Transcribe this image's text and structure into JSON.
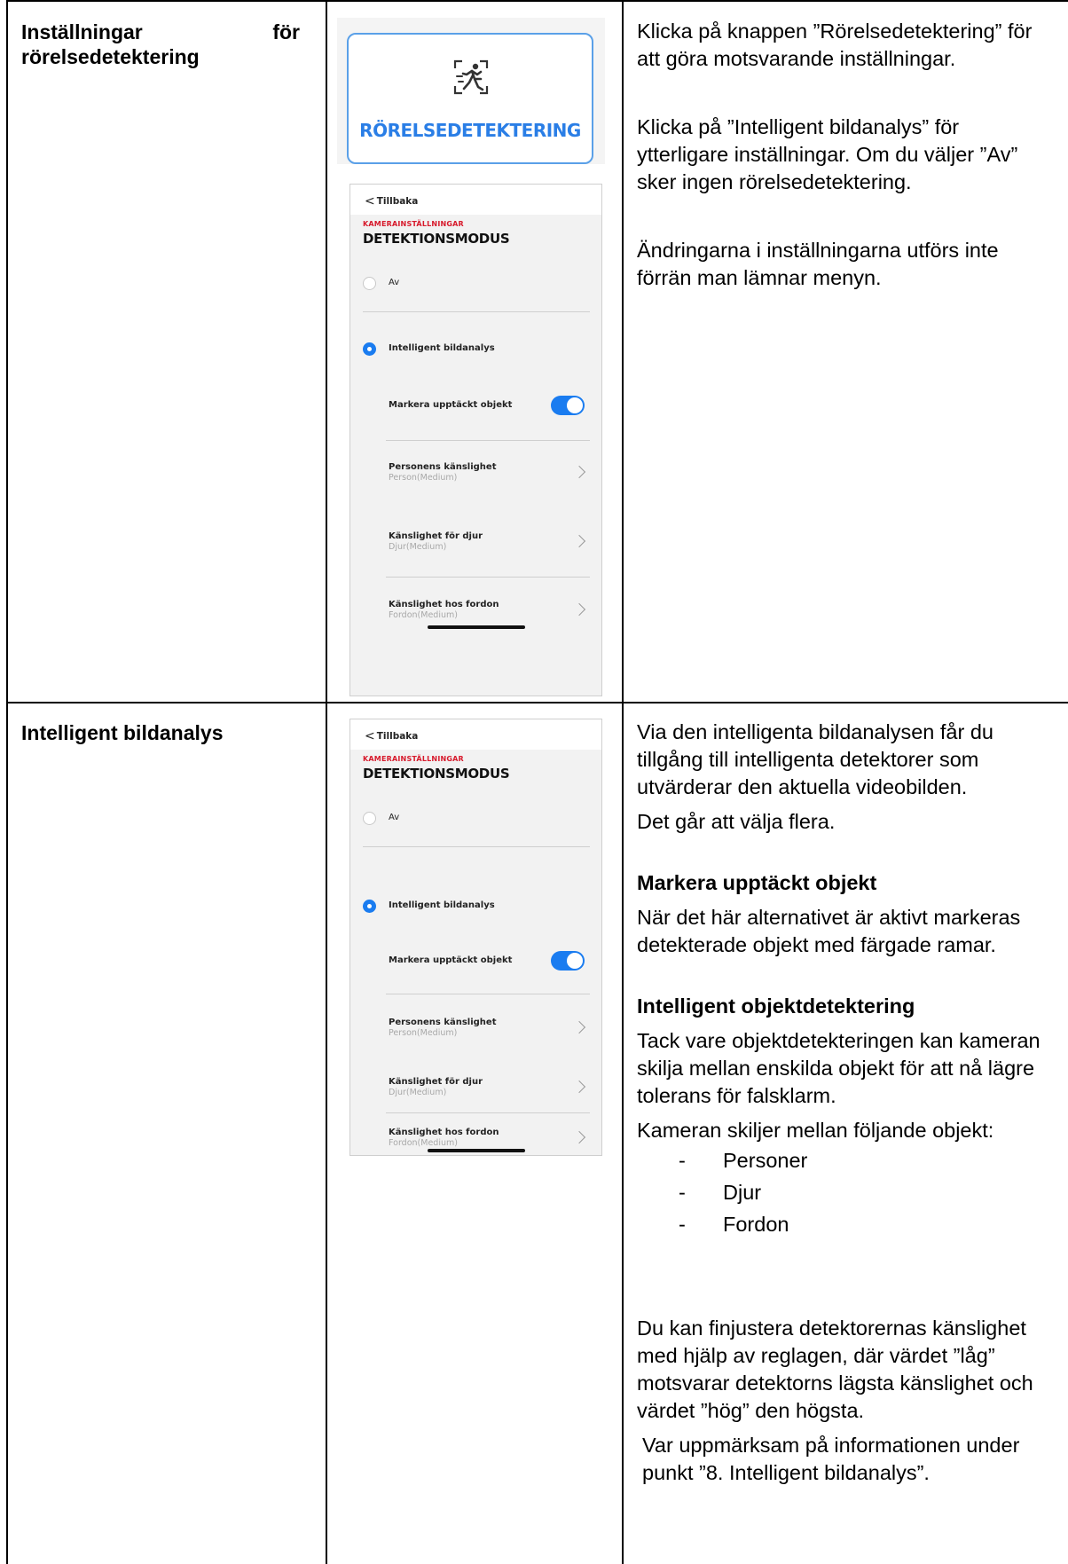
{
  "rows": [
    {
      "title_words": [
        "Inställningar",
        "för"
      ],
      "title_line2": "rörelsedetektering",
      "motion_button_label": "RÖRELSEDETEKTERING",
      "motion_icon": "running-person-detection-icon",
      "description": [
        "Klicka på knappen ”Rörelsedetektering” för att göra motsvarande inställningar.",
        "Klicka på ”Intelligent bildanalys” för ytterligare inställningar. Om du väljer ”Av” sker ingen rörelsedetektering.",
        "Ändringarna i inställningarna utförs inte förrän man lämnar menyn."
      ]
    },
    {
      "title": "Intelligent bildanalys",
      "intro": [
        "Via den intelligenta bildanalysen får du tillgång till intelligenta detektorer som utvärderar den aktuella videobilden.",
        "Det går att välja flera."
      ],
      "section1_heading": "Markera upptäckt objekt",
      "section1_text": "När det här alternativet är aktivt markeras detekterade objekt med färgade ramar.",
      "section2_heading": "Intelligent objektdetektering",
      "section2_text": "Tack vare objektdetekteringen kan kameran skilja mellan enskilda objekt för att nå lägre tolerans för falsklarm.",
      "section2_list_intro": "Kameran skiljer mellan följande objekt:",
      "objects": [
        "Personer",
        "Djur",
        "Fordon"
      ],
      "list_bullet": "-",
      "outro1": "Du kan finjustera detektorernas känslighet med hjälp av reglagen, där värdet ”låg” motsvarar detektorns lägsta känslighet och värdet ”hög” den högsta.",
      "outro2": "Var uppmärksam på informationen under punkt ”8. Intelligent bildanalys”."
    }
  ],
  "phone": {
    "back_label": "Tillbaka",
    "subheading": "KAMERAINSTÄLLNINGAR",
    "heading": "DETEKTIONSMODUS",
    "option_off": "Av",
    "option_on": "Intelligent bildanalys",
    "selected_option": "Intelligent bildanalys",
    "toggle_label": "Markera upptäckt objekt",
    "toggle_on": true,
    "accent_color": "#1a7cf0",
    "sensitivities": [
      {
        "title": "Personens känslighet",
        "value": "Person(Medium)"
      },
      {
        "title": "Känslighet för djur",
        "value": "Djur(Medium)"
      },
      {
        "title": "Känslighet hos fordon",
        "value": "Fordon(Medium)"
      }
    ]
  }
}
